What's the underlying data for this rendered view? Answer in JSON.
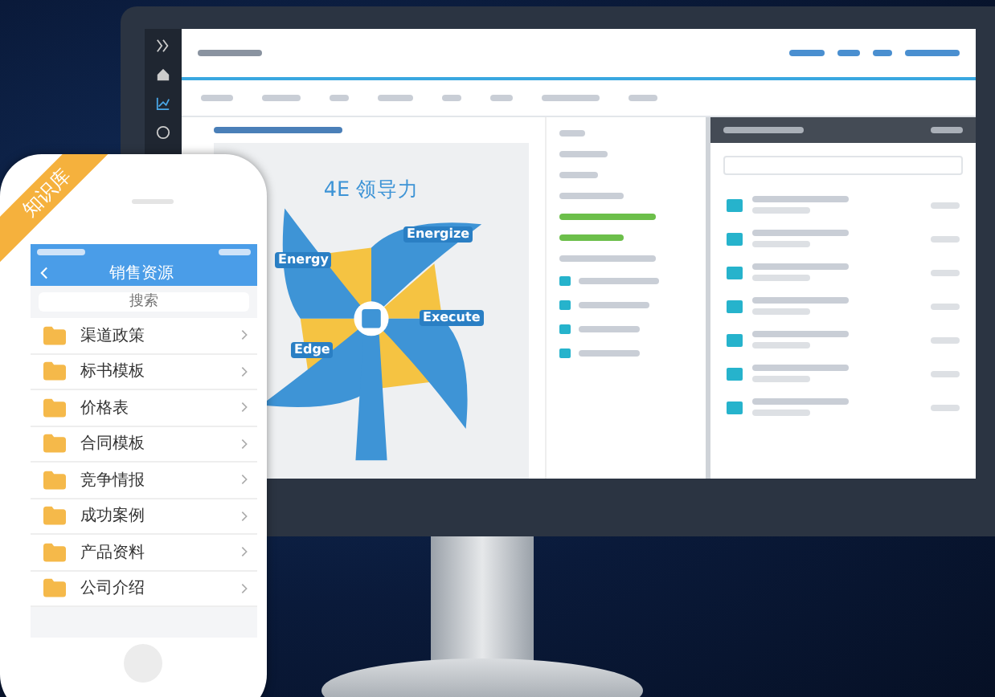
{
  "phone": {
    "badge": "知识库",
    "title": "销售资源",
    "search": {
      "placeholder": "搜索"
    },
    "folders": [
      {
        "name": "渠道政策"
      },
      {
        "name": "标书模板"
      },
      {
        "name": "价格表"
      },
      {
        "name": "合同模板"
      },
      {
        "name": "竞争情报"
      },
      {
        "name": "成功案例"
      },
      {
        "name": "产品资料"
      },
      {
        "name": "公司介绍"
      }
    ]
  },
  "desktop": {
    "preview": {
      "title": "4E 领导力",
      "petals": [
        {
          "label": "Energy"
        },
        {
          "label": "Energize"
        },
        {
          "label": "Execute"
        },
        {
          "label": "Edge"
        }
      ]
    }
  }
}
